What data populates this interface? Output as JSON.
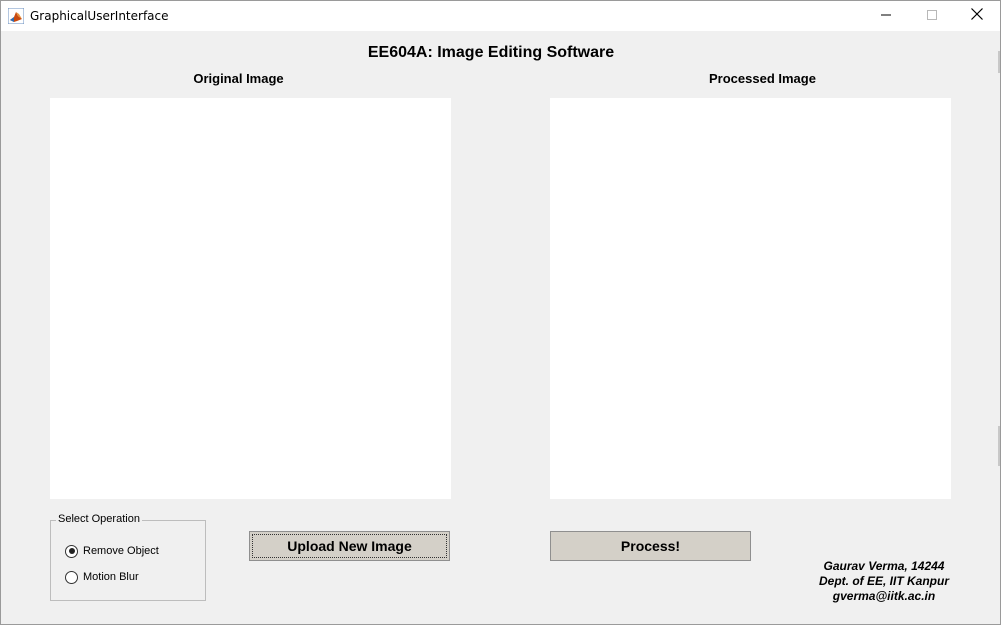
{
  "window": {
    "title": "GraphicalUserInterface",
    "controls": {
      "minimize": "minimize",
      "maximize": "maximize",
      "close": "close"
    }
  },
  "app": {
    "title": "EE604A: Image Editing Software",
    "original_label": "Original Image",
    "processed_label": "Processed Image"
  },
  "operation": {
    "group_label": "Select Operation",
    "options": [
      {
        "label": "Remove Object",
        "checked": true
      },
      {
        "label": "Motion Blur",
        "checked": false
      }
    ]
  },
  "buttons": {
    "upload_label": "Upload New Image",
    "process_label": "Process!"
  },
  "credits": {
    "line1": "Gaurav Verma, 14244",
    "line2": "Dept. of EE, IIT Kanpur",
    "line3": "gverma@iitk.ac.in"
  },
  "icons": {
    "app": "matlab-icon",
    "minimize": "minimize-icon",
    "maximize": "maximize-icon",
    "close": "close-icon"
  }
}
